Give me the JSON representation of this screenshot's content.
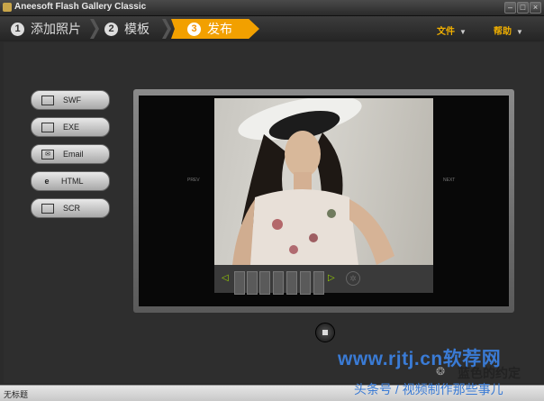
{
  "window": {
    "title": "Aneesoft Flash Gallery Classic"
  },
  "steps": [
    {
      "num": "1",
      "label": "添加照片"
    },
    {
      "num": "2",
      "label": "模板"
    },
    {
      "num": "3",
      "label": "发布"
    }
  ],
  "menus": {
    "file": "文件",
    "help": "帮助"
  },
  "publish_buttons": [
    {
      "label": "SWF",
      "icon": "swf-icon"
    },
    {
      "label": "EXE",
      "icon": "exe-icon"
    },
    {
      "label": "Email",
      "icon": "email-icon"
    },
    {
      "label": "HTML",
      "icon": "html-icon"
    },
    {
      "label": "SCR",
      "icon": "monitor-icon"
    }
  ],
  "preview": {
    "prev": "PREV",
    "next": "NEXT"
  },
  "status": {
    "text": "无标题"
  },
  "watermark": {
    "site": "www.rjtj.cn软荐网",
    "name": "蓝色的约定",
    "source": "头条号 / 视频制作那些事儿"
  },
  "colors": {
    "accent": "#f2a000",
    "panel": "#2e2e2e",
    "watermark_blue": "#3a7bd5"
  }
}
